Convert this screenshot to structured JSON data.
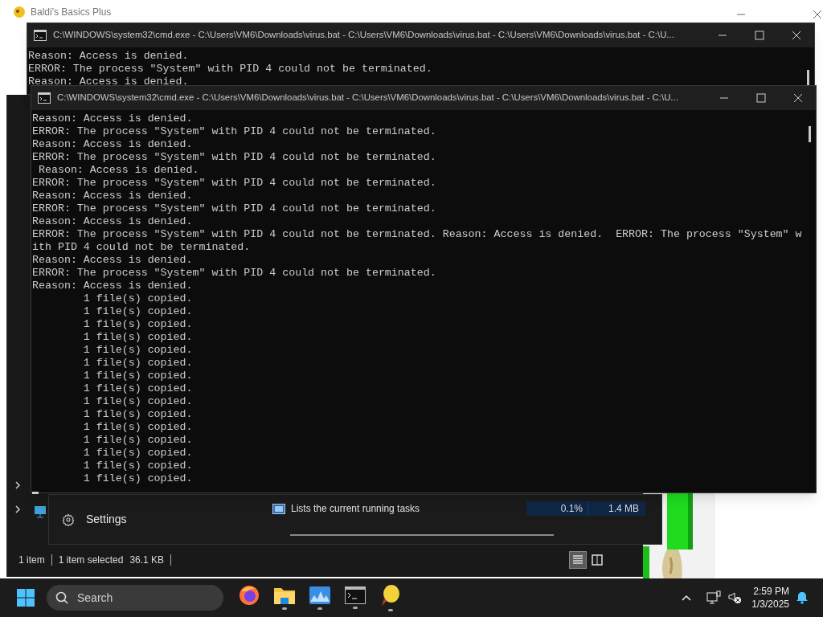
{
  "game_window": {
    "title": "Baldi's Basics Plus"
  },
  "console_windows": [
    {
      "title": "C:\\WINDOWS\\system32\\cmd.exe - C:\\Users\\VM6\\Downloads\\virus.bat - C:\\Users\\VM6\\Downloads\\virus.bat - C:\\Users\\VM6\\Downloads\\virus.bat - C:\\U...",
      "lines": [
        "Reason: Access is denied.",
        "ERROR: The process \"System\" with PID 4 could not be terminated.",
        "Reason: Access is denied."
      ]
    },
    {
      "title": "C:\\WINDOWS\\system32\\cmd.exe - C:\\Users\\VM6\\Downloads\\virus.bat - C:\\Users\\VM6\\Downloads\\virus.bat - C:\\Users\\VM6\\Downloads\\virus.bat - C:\\U...",
      "lines": [
        "Reason: Access is denied.",
        "ERROR: The process \"System\" with PID 4 could not be terminated.",
        "Reason: Access is denied.",
        "ERROR: The process \"System\" with PID 4 could not be terminated.",
        " Reason: Access is denied.",
        "ERROR: The process \"System\" with PID 4 could not be terminated.",
        "Reason: Access is denied.",
        "ERROR: The process \"System\" with PID 4 could not be terminated.",
        "Reason: Access is denied.",
        "ERROR: The process \"System\" with PID 4 could not be terminated. Reason: Access is denied.  ERROR: The process \"System\" w",
        "ith PID 4 could not be terminated.",
        "Reason: Access is denied.",
        "ERROR: The process \"System\" with PID 4 could not be terminated.",
        "Reason: Access is denied.",
        "        1 file(s) copied.",
        "        1 file(s) copied.",
        "        1 file(s) copied.",
        "        1 file(s) copied.",
        "        1 file(s) copied.",
        "        1 file(s) copied.",
        "        1 file(s) copied.",
        "        1 file(s) copied.",
        "        1 file(s) copied.",
        "        1 file(s) copied.",
        "        1 file(s) copied.",
        "        1 file(s) copied.",
        "        1 file(s) copied.",
        "        1 file(s) copied.",
        "        1 file(s) copied."
      ]
    }
  ],
  "explorer": {
    "status_items": [
      "1 item",
      "1 item selected",
      "36.1 KB"
    ],
    "views": [
      {
        "kind": "details",
        "selected": true
      },
      {
        "kind": "tiles",
        "selected": false
      }
    ]
  },
  "task_popup": {
    "settings_label": "Settings",
    "rows": [
      {
        "description": "Lists the current running tasks",
        "cpu": "0.1%",
        "memory": "1.4 MB"
      }
    ]
  },
  "taskbar": {
    "search_placeholder": "Search",
    "apps": [
      {
        "kind": "browser",
        "running": false
      },
      {
        "kind": "folder",
        "running": true
      },
      {
        "kind": "monitor",
        "running": true
      },
      {
        "kind": "console",
        "running": true
      },
      {
        "kind": "game",
        "running": true
      }
    ],
    "time": "2:59 PM",
    "date": "1/3/2025"
  }
}
